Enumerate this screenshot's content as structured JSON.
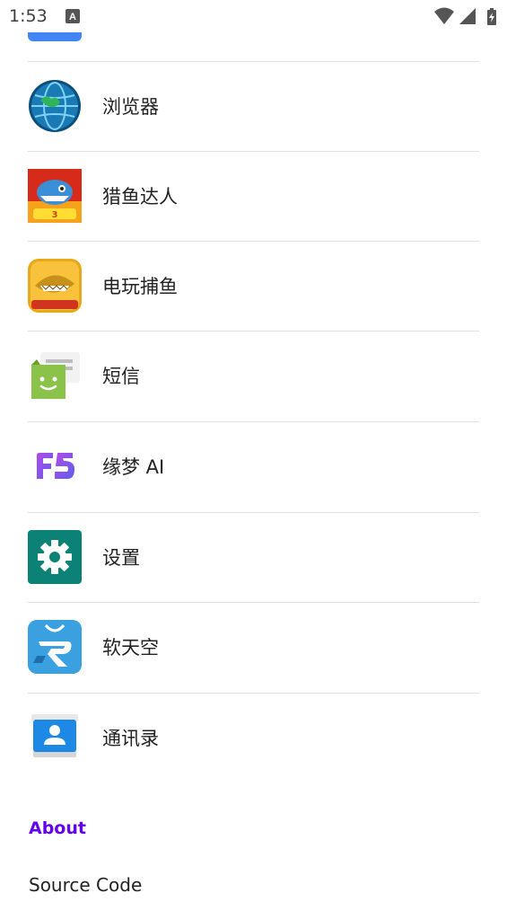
{
  "status_bar": {
    "time": "1:53"
  },
  "apps": [
    {
      "label": "浏览器",
      "icon": "globe-icon"
    },
    {
      "label": "猎鱼达人",
      "icon": "fishing-game-icon"
    },
    {
      "label": "电玩捕鱼",
      "icon": "shark-game-icon"
    },
    {
      "label": "短信",
      "icon": "messages-icon"
    },
    {
      "label": "缘梦 AI",
      "icon": "fs-logo-icon"
    },
    {
      "label": "设置",
      "icon": "gear-icon"
    },
    {
      "label": "软天空",
      "icon": "shopping-bag-icon"
    },
    {
      "label": "通讯录",
      "icon": "contacts-icon"
    }
  ],
  "about": {
    "header": "About",
    "source_code": "Source Code"
  },
  "colors": {
    "accent": "#6200ee",
    "divider": "#e0e0e0"
  }
}
